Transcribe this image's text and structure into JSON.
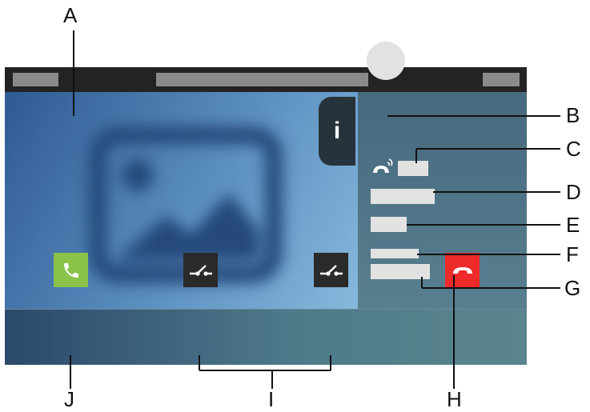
{
  "callouts": {
    "a": "A",
    "b": "B",
    "c": "C",
    "d": "D",
    "e": "E",
    "f": "F",
    "g": "G",
    "h": "H",
    "i": "I",
    "j": "J"
  },
  "info_tab": {
    "label": "i"
  },
  "icons": {
    "accept": "phone-icon",
    "door_1": "door-opener-icon",
    "door_2": "door-opener-icon",
    "hangup": "hang-up-icon",
    "call_state": "call-ringing-icon",
    "video": "image-placeholder-icon"
  },
  "colors": {
    "accept": "#8bc34a",
    "hangup": "#ee2a2a",
    "door": "#2a2a2a",
    "top_bar": "#232323",
    "info_tab": "#27333a"
  }
}
